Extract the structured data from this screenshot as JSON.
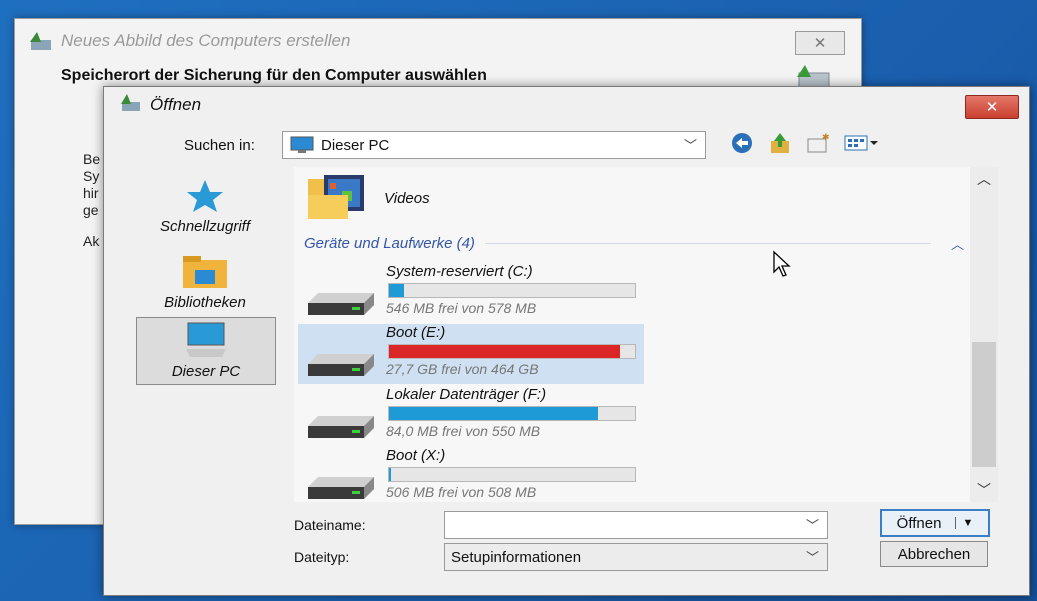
{
  "background_window": {
    "title": "Neues Abbild des Computers erstellen",
    "heading": "Speicherort der Sicherung für den Computer auswählen",
    "partial_text": [
      "Be",
      "Sy",
      "hir",
      "ge",
      "Ak"
    ]
  },
  "dialog": {
    "title": "Öffnen",
    "look_in_label": "Suchen in:",
    "look_in_value": "Dieser PC",
    "places": [
      {
        "label": "Schnellzugriff",
        "icon": "star-icon"
      },
      {
        "label": "Bibliotheken",
        "icon": "library-folder-icon"
      },
      {
        "label": "Dieser PC",
        "icon": "computer-icon",
        "selected": true
      }
    ],
    "list": {
      "folder": {
        "name": "Videos",
        "icon": "videos-folder-icon"
      },
      "group_header": "Geräte und Laufwerke (4)",
      "drives": [
        {
          "name": "System-reserviert (C:)",
          "info": "546 MB frei von 578 MB",
          "used_fraction": 0.06,
          "bar_color": "#1e9ad6",
          "selected": false
        },
        {
          "name": "Boot (E:)",
          "info": "27,7 GB frei von 464 GB",
          "used_fraction": 0.94,
          "bar_color": "#da2626",
          "selected": true
        },
        {
          "name": "Lokaler Datenträger (F:)",
          "info": "84,0 MB frei von 550 MB",
          "used_fraction": 0.85,
          "bar_color": "#1e9ad6",
          "selected": false
        },
        {
          "name": "Boot (X:)",
          "info": "506 MB frei von 508 MB",
          "used_fraction": 0.01,
          "bar_color": "#1e9ad6",
          "selected": false
        }
      ]
    },
    "filename_label": "Dateiname:",
    "filename_value": "",
    "filetype_label": "Dateityp:",
    "filetype_value": "Setupinformationen",
    "open_button": "Öffnen",
    "cancel_button": "Abbrechen",
    "close_glyph": "✕"
  }
}
